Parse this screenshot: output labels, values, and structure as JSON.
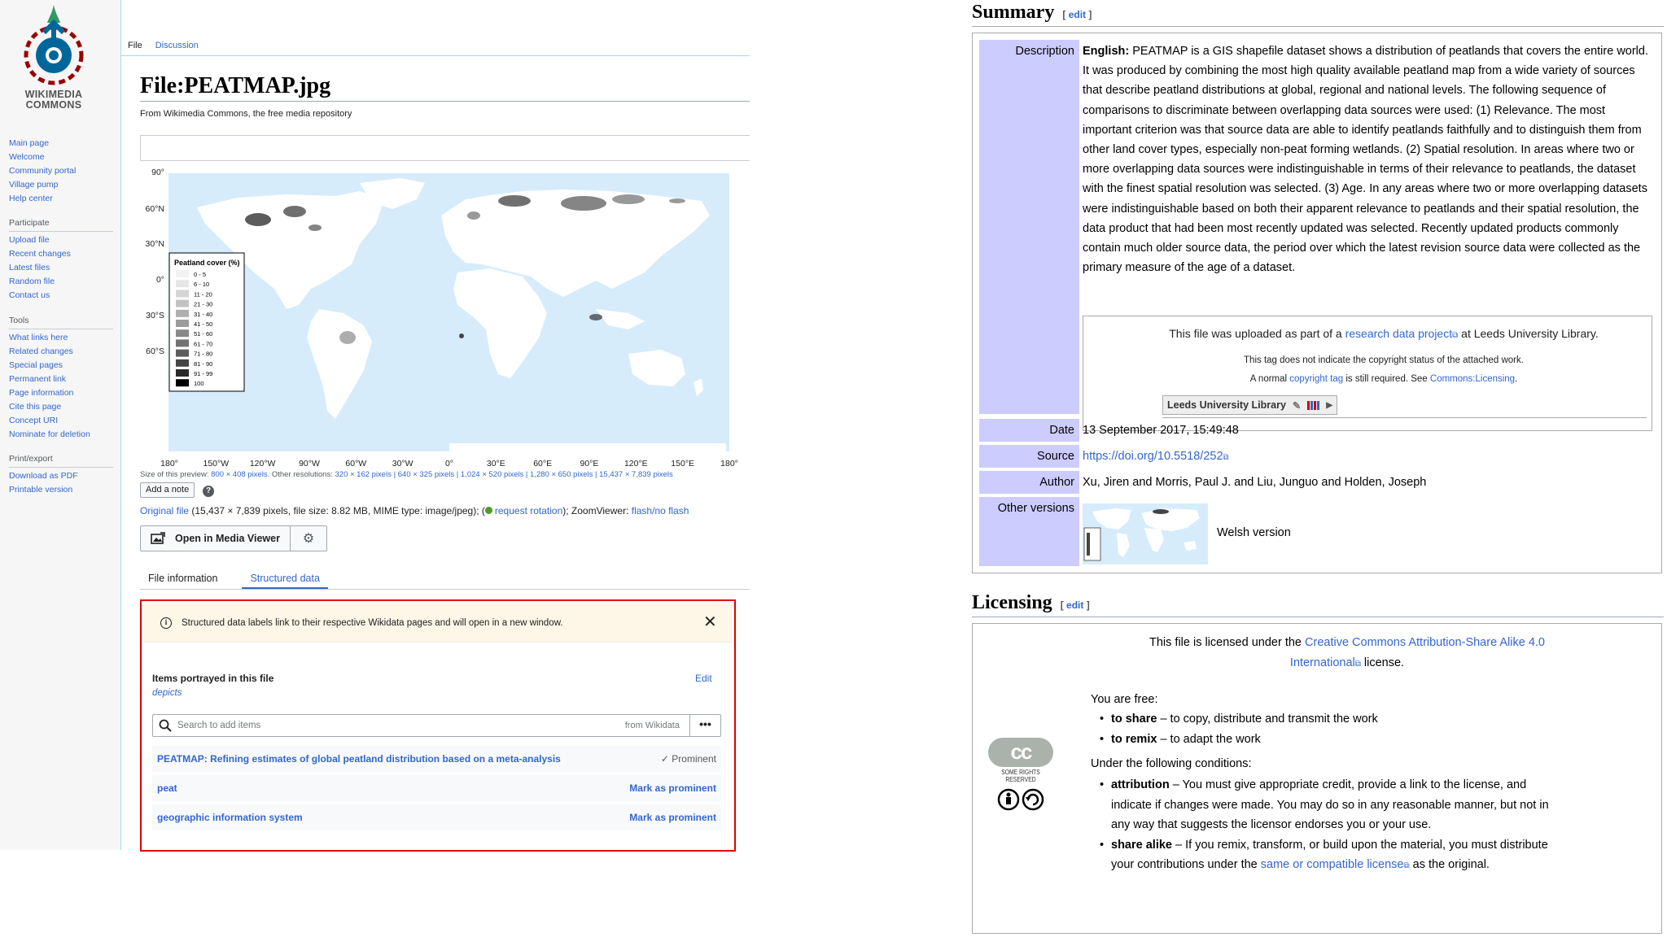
{
  "sidebar": {
    "logo_text": [
      "WIKIMEDIA",
      "COMMONS"
    ],
    "nav": [
      "Main page",
      "Welcome",
      "Community portal",
      "Village pump",
      "Help center"
    ],
    "participate_heading": "Participate",
    "participate": [
      "Upload file",
      "Recent changes",
      "Latest files",
      "Random file",
      "Contact us"
    ],
    "tools_heading": "Tools",
    "tools": [
      "What links here",
      "Related changes",
      "Special pages",
      "Permanent link",
      "Page information",
      "Cite this page",
      "Concept URI",
      "Nominate for deletion"
    ],
    "print_heading": "Print/export",
    "print": [
      "Download as PDF",
      "Printable version"
    ]
  },
  "page_tabs": {
    "file": "File",
    "discussion": "Discussion"
  },
  "page": {
    "title": "File:PEATMAP.jpg",
    "subtitle": "From Wikimedia Commons, the free media repository"
  },
  "map": {
    "lat_labels": [
      "90°",
      "60°N",
      "30°N",
      "0°",
      "30°S",
      "60°S"
    ],
    "lon_labels": [
      "180°",
      "150°W",
      "120°W",
      "90°W",
      "60°W",
      "30°W",
      "0°",
      "30°E",
      "60°E",
      "90°E",
      "120°E",
      "150°E",
      "180°"
    ],
    "legend_title": "Peatland cover (%)",
    "legend_items": [
      "0 - 5",
      "6 - 10",
      "11 - 20",
      "21 - 30",
      "31 - 40",
      "41 - 50",
      "51 - 60",
      "61 - 70",
      "71 - 80",
      "81 - 90",
      "91 - 99",
      "100"
    ],
    "legend_colors": [
      "#f2f2f2",
      "#e6e6e6",
      "#d4d4d4",
      "#c2c2c2",
      "#afafaf",
      "#9c9c9c",
      "#888888",
      "#727272",
      "#5c5c5c",
      "#444444",
      "#2a2a2a",
      "#000000"
    ],
    "ocean_color": "#d6ecfb"
  },
  "file_meta": {
    "preview_size_prefix": "Size of this preview: ",
    "preview_size_link": "800 × 408 pixels",
    "other_res_prefix": ". Other resolutions: ",
    "other_res_links": "320 × 162 pixels | 640 × 325 pixels | 1,024 × 520 pixels | 1,280 × 650 pixels | 15,437 × 7,839 pixels",
    "add_note": "Add a note",
    "help": "?",
    "original_file_link": "Original file",
    "original_file_details": " (15,437 × 7,839 pixels, file size: 8.82 MB, MIME type: image/jpeg); (",
    "request_rotation": "request rotation",
    "zoomviewer_label": "); ZoomViewer: ",
    "zoomviewer_link": "flash/no flash"
  },
  "media_viewer": {
    "open_label": "Open in Media Viewer"
  },
  "info_tabs": {
    "file_information": "File information",
    "structured_data": "Structured data"
  },
  "structured_data": {
    "notice": "Structured data labels link to their respective Wikidata pages and will open in a new window.",
    "close": "✕",
    "items_label": "Items portrayed in this file",
    "depicts": "depicts",
    "edit": "Edit",
    "search_placeholder": "Search to add items",
    "from_wikidata": "from Wikidata",
    "more": "•••",
    "rows": [
      {
        "value": "PEATMAP: Refining estimates of global peatland distribution based on a meta-analysis",
        "action": "✓ Prominent"
      },
      {
        "value": "peat",
        "action": "Mark as prominent"
      },
      {
        "value": "geographic information system",
        "action": "Mark as prominent"
      }
    ]
  },
  "summary": {
    "heading": "Summary",
    "edit": "edit",
    "description_label": "Description",
    "description_lang": "English:",
    "description_text": " PEATMAP is a GIS shapefile dataset shows a distribution of peatlands that covers the entire world. It was produced by combining the most high quality available peatland map from a wide variety of sources that describe peatland distributions at global, regional and national levels. The following sequence of comparisons to discriminate between overlapping data sources were used: (1) Relevance. The most important criterion was that source data are able to identify peatlands faithfully and to distinguish them from other land cover types, especially non-peat forming wetlands. (2) Spatial resolution. In areas where two or more overlapping data sources were indistinguishable in terms of their relevance to peatlands, the dataset with the finest spatial resolution was selected. (3) Age. In any areas where two or more overlapping datasets were indistinguishable based on both their apparent relevance to peatlands and their spatial resolution, the data product that had been most recently updated was selected. Recently updated products commonly contain much older source data, the period over which the latest revision source data were collected as the primary measure of the age of a dataset.",
    "uploaded_prefix": "This file was uploaded as part of a ",
    "uploaded_link": "research data project",
    "uploaded_suffix": " at Leeds University Library.",
    "tag_note": "This tag does not indicate the copyright status of the attached work.",
    "normal_prefix": "A normal ",
    "copyright_tag": "copyright tag",
    "normal_mid": " is still required. See ",
    "commons_licensing": "Commons:Licensing",
    "normal_suffix": ".",
    "leeds_badge": "Leeds University Library",
    "date_label": "Date",
    "date_value": "13 September 2017, 15:49:48",
    "source_label": "Source",
    "source_value": "https://doi.org/10.5518/252",
    "author_label": "Author",
    "author_value": "Xu, Jiren and Morris, Paul J. and Liu, Junguo and Holden, Joseph",
    "other_versions_label": "Other versions",
    "other_versions_value": "Welsh version"
  },
  "licensing": {
    "heading": "Licensing",
    "edit": "edit",
    "licensed_prefix": "This file is licensed under the ",
    "license_link_1": "Creative Commons Attribution-Share Alike 4.0",
    "license_link_2": "International",
    "licensed_suffix": " license.",
    "you_are_free": "You are free:",
    "share_term": "to share",
    "share_desc": " – to copy, distribute and transmit the work",
    "remix_term": "to remix",
    "remix_desc": " – to adapt the work",
    "conditions": "Under the following conditions:",
    "attribution_term": "attribution",
    "attribution_desc": " – You must give appropriate credit, provide a link to the license, and indicate if changes were made. You may do so in any reasonable manner, but not in any way that suggests the licensor endorses you or your use.",
    "sharealike_term": "share alike",
    "sharealike_desc_1": " – If you remix, transform, or build upon the material, you must distribute your contributions under the ",
    "sharealike_link": "same or compatible license",
    "sharealike_desc_2": " as the original.",
    "cc_text": "cc",
    "cc_sub": "SOME RIGHTS RESERVED"
  },
  "colors": {
    "accent": "#3366cc",
    "highlight_border": "#e00000",
    "label_bg": "#ccccff",
    "notice_bg": "#fef6e7"
  }
}
